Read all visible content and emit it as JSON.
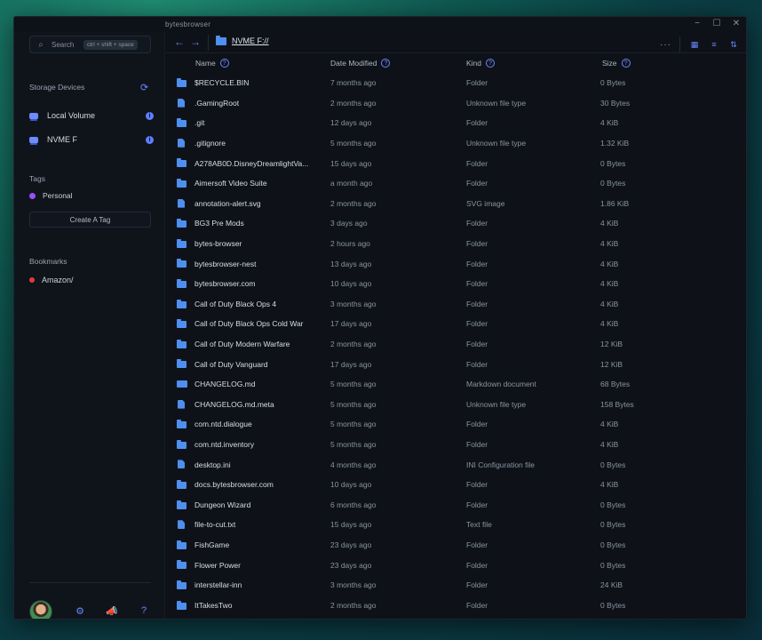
{
  "window": {
    "title": "bytesbrowser"
  },
  "search": {
    "placeholder": "Search",
    "shortcut": "ctrl + shift + space"
  },
  "sidebar": {
    "storage_title": "Storage Devices",
    "devices": [
      {
        "label": "Local Volume"
      },
      {
        "label": "NVME F"
      }
    ],
    "tags_title": "Tags",
    "tags": [
      {
        "label": "Personal",
        "color": "#9b4dff"
      }
    ],
    "create_tag_label": "Create A Tag",
    "bookmarks_title": "Bookmarks",
    "bookmarks": [
      {
        "label": "Amazon/",
        "color": "#e23b3b"
      }
    ]
  },
  "toolbar": {
    "path": "NVME F://"
  },
  "columns": {
    "name": "Name",
    "date": "Date Modified",
    "kind": "Kind",
    "size": "Size"
  },
  "files": [
    {
      "icon": "folder",
      "name": "$RECYCLE.BIN",
      "date": "7 months ago",
      "kind": "Folder",
      "size": "0 Bytes"
    },
    {
      "icon": "file",
      "name": ".GamingRoot",
      "date": "2 months ago",
      "kind": "Unknown file type",
      "size": "30 Bytes"
    },
    {
      "icon": "folder",
      "name": ".git",
      "date": "12 days ago",
      "kind": "Folder",
      "size": "4 KiB"
    },
    {
      "icon": "file",
      "name": ".gitignore",
      "date": "5 months ago",
      "kind": "Unknown file type",
      "size": "1.32 KiB"
    },
    {
      "icon": "folder",
      "name": "A278AB0D.DisneyDreamlightVa...",
      "date": "15 days ago",
      "kind": "Folder",
      "size": "0 Bytes"
    },
    {
      "icon": "folder",
      "name": "Aimersoft Video Suite",
      "date": "a month ago",
      "kind": "Folder",
      "size": "0 Bytes"
    },
    {
      "icon": "file",
      "name": "annotation-alert.svg",
      "date": "2 months ago",
      "kind": "SVG image",
      "size": "1.86 KiB"
    },
    {
      "icon": "folder",
      "name": "BG3 Pre Mods",
      "date": "3 days ago",
      "kind": "Folder",
      "size": "4 KiB"
    },
    {
      "icon": "folder",
      "name": "bytes-browser",
      "date": "2 hours ago",
      "kind": "Folder",
      "size": "4 KiB"
    },
    {
      "icon": "folder",
      "name": "bytesbrowser-nest",
      "date": "13 days ago",
      "kind": "Folder",
      "size": "4 KiB"
    },
    {
      "icon": "folder",
      "name": "bytesbrowser.com",
      "date": "10 days ago",
      "kind": "Folder",
      "size": "4 KiB"
    },
    {
      "icon": "folder",
      "name": "Call of Duty Black Ops 4",
      "date": "3 months ago",
      "kind": "Folder",
      "size": "4 KiB"
    },
    {
      "icon": "folder",
      "name": "Call of Duty Black Ops Cold War",
      "date": "17 days ago",
      "kind": "Folder",
      "size": "4 KiB"
    },
    {
      "icon": "folder",
      "name": "Call of Duty Modern Warfare",
      "date": "2 months ago",
      "kind": "Folder",
      "size": "12 KiB"
    },
    {
      "icon": "folder",
      "name": "Call of Duty Vanguard",
      "date": "17 days ago",
      "kind": "Folder",
      "size": "12 KiB"
    },
    {
      "icon": "md",
      "name": "CHANGELOG.md",
      "date": "5 months ago",
      "kind": "Markdown document",
      "size": "68 Bytes"
    },
    {
      "icon": "file",
      "name": "CHANGELOG.md.meta",
      "date": "5 months ago",
      "kind": "Unknown file type",
      "size": "158 Bytes"
    },
    {
      "icon": "folder",
      "name": "com.ntd.dialogue",
      "date": "5 months ago",
      "kind": "Folder",
      "size": "4 KiB"
    },
    {
      "icon": "folder",
      "name": "com.ntd.inventory",
      "date": "5 months ago",
      "kind": "Folder",
      "size": "4 KiB"
    },
    {
      "icon": "file",
      "name": "desktop.ini",
      "date": "4 months ago",
      "kind": "INI Configuration file",
      "size": "0 Bytes"
    },
    {
      "icon": "folder",
      "name": "docs.bytesbrowser.com",
      "date": "10 days ago",
      "kind": "Folder",
      "size": "4 KiB"
    },
    {
      "icon": "folder",
      "name": "Dungeon Wizard",
      "date": "6 months ago",
      "kind": "Folder",
      "size": "0 Bytes"
    },
    {
      "icon": "file",
      "name": "file-to-cut.txt",
      "date": "15 days ago",
      "kind": "Text file",
      "size": "0 Bytes"
    },
    {
      "icon": "folder",
      "name": "FishGame",
      "date": "23 days ago",
      "kind": "Folder",
      "size": "0 Bytes"
    },
    {
      "icon": "folder",
      "name": "Flower Power",
      "date": "23 days ago",
      "kind": "Folder",
      "size": "0 Bytes"
    },
    {
      "icon": "folder",
      "name": "interstellar-inn",
      "date": "3 months ago",
      "kind": "Folder",
      "size": "24 KiB"
    },
    {
      "icon": "folder",
      "name": "ItTakesTwo",
      "date": "2 months ago",
      "kind": "Folder",
      "size": "0 Bytes"
    }
  ],
  "colors": {
    "accent": "#6b86ff",
    "folder": "#4e8ff0",
    "background": "#0e1218"
  }
}
